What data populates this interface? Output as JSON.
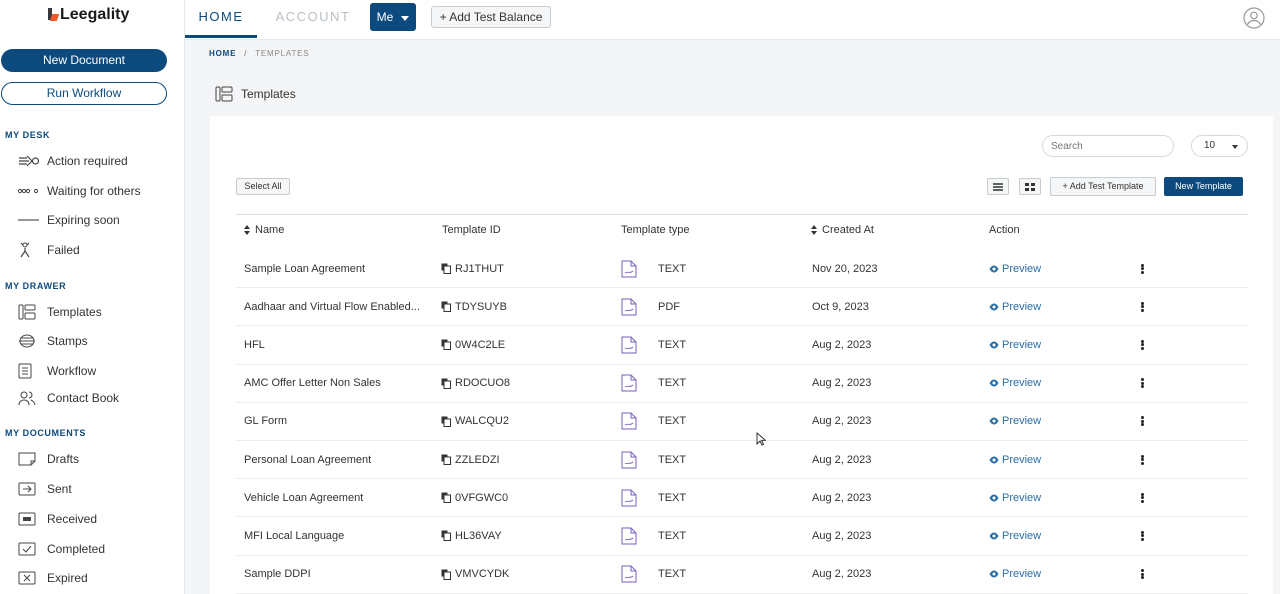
{
  "brand": {
    "logo_text": "Leegality"
  },
  "sidebar": {
    "new_document": "New Document",
    "run_workflow": "Run Workflow",
    "sections": [
      {
        "title": "MY DESK",
        "items": [
          {
            "label": "Action required",
            "icon": "arrow-action-icon"
          },
          {
            "label": "Waiting for others",
            "icon": "dots-waiting-icon"
          },
          {
            "label": "Expiring soon",
            "icon": "line-expiring-icon"
          },
          {
            "label": "Failed",
            "icon": "failed-person-icon"
          }
        ]
      },
      {
        "title": "MY DRAWER",
        "items": [
          {
            "label": "Templates",
            "icon": "templates-icon"
          },
          {
            "label": "Stamps",
            "icon": "stamps-icon"
          },
          {
            "label": "Workflow",
            "icon": "workflow-icon"
          },
          {
            "label": "Contact Book",
            "icon": "contacts-icon"
          }
        ]
      },
      {
        "title": "MY DOCUMENTS",
        "items": [
          {
            "label": "Drafts",
            "icon": "drafts-icon"
          },
          {
            "label": "Sent",
            "icon": "sent-icon"
          },
          {
            "label": "Received",
            "icon": "received-icon"
          },
          {
            "label": "Completed",
            "icon": "completed-icon"
          },
          {
            "label": "Expired",
            "icon": "expired-icon"
          }
        ]
      }
    ]
  },
  "topbar": {
    "tab_home": "HOME",
    "tab_account": "ACCOUNT",
    "me_label": "Me",
    "add_test_balance": "+ Add Test Balance"
  },
  "breadcrumb": {
    "home": "HOME",
    "separator": "/",
    "current": "TEMPLATES"
  },
  "page": {
    "title": "Templates"
  },
  "toolbar": {
    "search_placeholder": "Search",
    "page_size": "10",
    "select_all": "Select All",
    "add_test_template": "+ Add Test Template",
    "new_template": "New Template"
  },
  "table": {
    "columns": {
      "name": "Name",
      "template_id": "Template ID",
      "template_type": "Template type",
      "created_at": "Created At",
      "action": "Action"
    },
    "preview_label": "Preview",
    "rows": [
      {
        "name": "Sample Loan Agreement",
        "id": "RJ1THUT",
        "type": "TEXT",
        "created": "Nov 20, 2023"
      },
      {
        "name": "Aadhaar and Virtual Flow Enabled...",
        "id": "TDYSUYB",
        "type": "PDF",
        "created": "Oct 9, 2023"
      },
      {
        "name": "HFL",
        "id": "0W4C2LE",
        "type": "TEXT",
        "created": "Aug 2, 2023"
      },
      {
        "name": "AMC Offer Letter Non Sales",
        "id": "RDOCUO8",
        "type": "TEXT",
        "created": "Aug 2, 2023"
      },
      {
        "name": "GL Form",
        "id": "WALCQU2",
        "type": "TEXT",
        "created": "Aug 2, 2023"
      },
      {
        "name": "Personal Loan Agreement",
        "id": "ZZLEDZI",
        "type": "TEXT",
        "created": "Aug 2, 2023"
      },
      {
        "name": "Vehicle Loan Agreement",
        "id": "0VFGWC0",
        "type": "TEXT",
        "created": "Aug 2, 2023"
      },
      {
        "name": "MFI Local Language",
        "id": "HL36VAY",
        "type": "TEXT",
        "created": "Aug 2, 2023"
      },
      {
        "name": "Sample DDPI",
        "id": "VMVCYDK",
        "type": "TEXT",
        "created": "Aug 2, 2023"
      }
    ]
  },
  "colors": {
    "primary": "#0c4a7e",
    "link": "#2a6fa8",
    "doc_icon": "#7a5fc0",
    "logo_accent": "#f15a29"
  }
}
